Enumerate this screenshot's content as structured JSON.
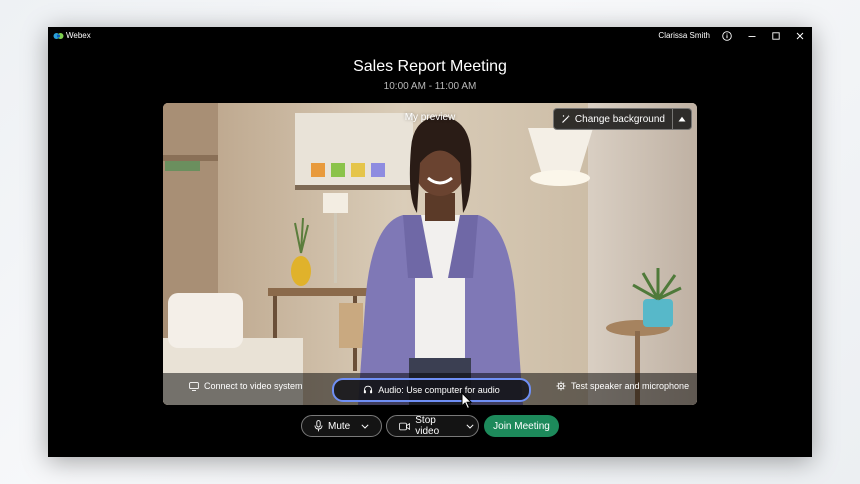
{
  "window": {
    "app_name": "Webex",
    "user_name": "Clarissa Smith",
    "icons": [
      "webex-logo-icon",
      "info-icon",
      "minimize-icon",
      "maximize-icon",
      "close-icon"
    ]
  },
  "meeting": {
    "title": "Sales Report Meeting",
    "time": "10:00 AM - 11:00 AM"
  },
  "preview": {
    "label": "My preview",
    "change_background_label": "Change background",
    "options": {
      "connect_video": "Connect to video system",
      "audio": "Audio: Use computer for audio",
      "test_speaker": "Test speaker and microphone"
    }
  },
  "controls": {
    "mute_label": "Mute",
    "stop_video_label": "Stop video",
    "join_label": "Join Meeting"
  },
  "colors": {
    "window_bg": "#000000",
    "join_button": "#1d8a5b",
    "audio_focus_ring": "#6f8ff5"
  }
}
